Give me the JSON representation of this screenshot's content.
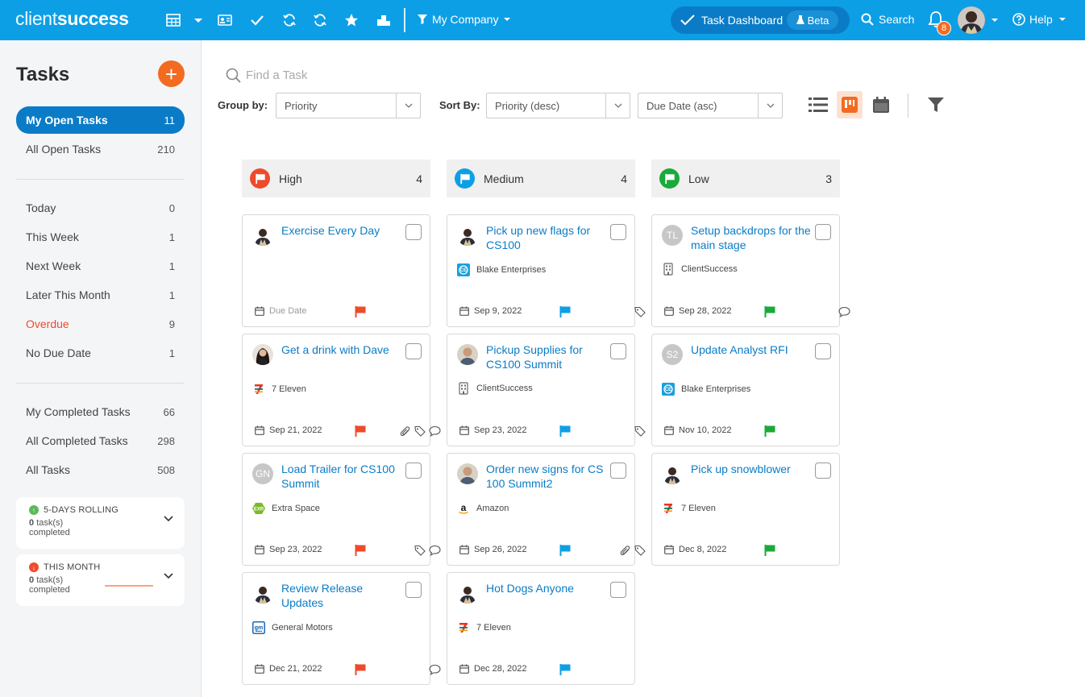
{
  "brand": {
    "logo_light": "client",
    "logo_bold": "success",
    "primary": "#0d9fe6",
    "accent": "#f26b21"
  },
  "topbar": {
    "company_label": "My Company",
    "dashboard_label": "Task Dashboard",
    "beta_label": "Beta",
    "search_label": "Search",
    "notifications_count": "8",
    "help_label": "Help"
  },
  "sidebar": {
    "title": "Tasks",
    "add_icon": "plus-icon",
    "groups": [
      [
        {
          "label": "My Open Tasks",
          "count": "11",
          "active": true
        },
        {
          "label": "All Open Tasks",
          "count": "210"
        }
      ],
      [
        {
          "label": "Today",
          "count": "0"
        },
        {
          "label": "This Week",
          "count": "1"
        },
        {
          "label": "Next Week",
          "count": "1"
        },
        {
          "label": "Later This Month",
          "count": "1"
        },
        {
          "label": "Overdue",
          "count": "9",
          "overdue": true
        },
        {
          "label": "No Due Date",
          "count": "1"
        }
      ],
      [
        {
          "label": "My Completed Tasks",
          "count": "66"
        },
        {
          "label": "All Completed Tasks",
          "count": "298"
        },
        {
          "label": "All Tasks",
          "count": "508"
        }
      ]
    ],
    "stats": [
      {
        "title": "5-DAYS ROLLING",
        "count": "0",
        "line1": "task(s)",
        "line2": "completed",
        "trend": "up",
        "color": "#5cb85c"
      },
      {
        "title": "THIS MONTH",
        "count": "0",
        "line1": "task(s)",
        "line2": "completed",
        "trend": "down",
        "color": "#ee4b2b"
      }
    ]
  },
  "toolbar": {
    "find_placeholder": "Find a Task",
    "group_by_label": "Group by:",
    "group_by_value": "Priority",
    "sort_by_label": "Sort By:",
    "sort_primary": "Priority (desc)",
    "sort_secondary": "Due Date (asc)"
  },
  "board": {
    "columns": [
      {
        "name": "High",
        "count": "4",
        "color": "#ee4b2b",
        "cards": [
          {
            "title": "Exercise Every Day",
            "avatar": "photo",
            "account": "",
            "due": "Due Date",
            "due_placeholder": true,
            "extras": []
          },
          {
            "title": "Get a drink with Dave",
            "avatar": "photo-f",
            "account": "7 Eleven",
            "account_logo": "7-eleven",
            "due": "Sep 21, 2022",
            "extras": [
              "paperclip-icon",
              "tag-icon",
              "comment-icon"
            ]
          },
          {
            "title": "Load Trailer for CS100 Summit",
            "avatar": "GN",
            "account": "Extra Space",
            "account_logo": "extra-space",
            "due": "Sep 23, 2022",
            "extras": [
              "tag-icon",
              "comment-icon"
            ]
          },
          {
            "title": "Review Release Updates",
            "avatar": "photo",
            "account": "General Motors",
            "account_logo": "gm",
            "due": "Dec 21, 2022",
            "extras": [
              "comment-icon"
            ]
          }
        ]
      },
      {
        "name": "Medium",
        "count": "4",
        "color": "#0d9fe6",
        "cards": [
          {
            "title": "Pick up new flags for CS100",
            "avatar": "photo",
            "account": "Blake Enterprises",
            "account_logo": "blake",
            "due": "Sep 9, 2022",
            "extras": [
              "tag-icon"
            ]
          },
          {
            "title": "Pickup Supplies for CS100 Summit",
            "avatar": "photo-b",
            "account": "ClientSuccess",
            "account_logo": "building",
            "due": "Sep 23, 2022",
            "extras": [
              "tag-icon"
            ]
          },
          {
            "title": "Order new signs for CS 100 Summit2",
            "avatar": "photo-b",
            "account": "Amazon",
            "account_logo": "amazon",
            "due": "Sep 26, 2022",
            "extras": [
              "paperclip-icon",
              "tag-icon"
            ]
          },
          {
            "title": "Hot Dogs Anyone",
            "avatar": "photo",
            "account": "7 Eleven",
            "account_logo": "7-eleven",
            "due": "Dec 28, 2022",
            "extras": []
          }
        ]
      },
      {
        "name": "Low",
        "count": "3",
        "color": "#1aaa3a",
        "cards": [
          {
            "title": "Setup backdrops for the main stage",
            "avatar": "TL",
            "account": "ClientSuccess",
            "account_logo": "building",
            "due": "Sep 28, 2022",
            "extras": [
              "comment-icon"
            ]
          },
          {
            "title": "Update Analyst RFI",
            "avatar": "S2",
            "account": "Blake Enterprises",
            "account_logo": "blake",
            "due": "Nov 10, 2022",
            "extras": []
          },
          {
            "title": "Pick up snowblower",
            "avatar": "photo",
            "account": "7 Eleven",
            "account_logo": "7-eleven",
            "due": "Dec 8, 2022",
            "extras": []
          }
        ]
      }
    ]
  }
}
